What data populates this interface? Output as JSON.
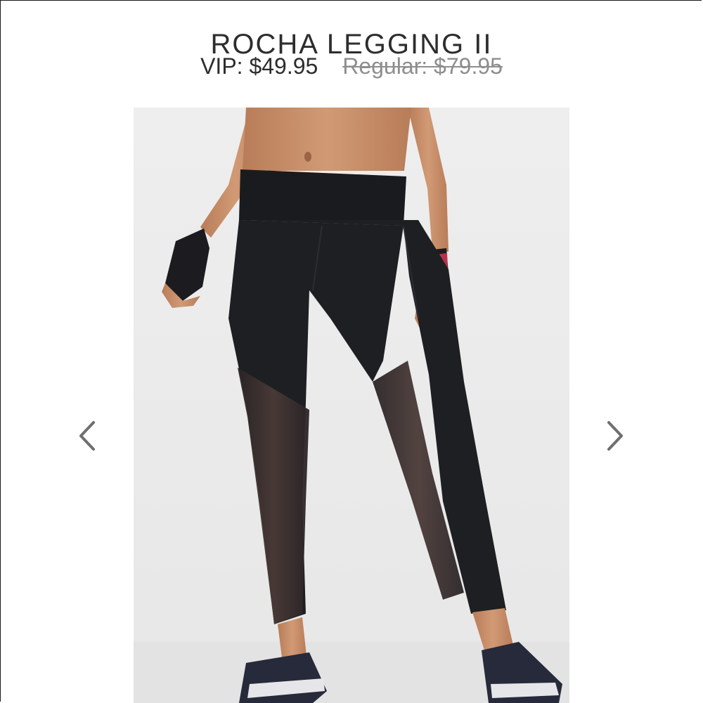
{
  "product": {
    "title": "ROCHA LEGGING II",
    "vip_price": "VIP: $49.95",
    "regular_price": "Regular: $79.95"
  },
  "carousel": {
    "prev_icon": "chevron-left-icon",
    "next_icon": "chevron-right-icon",
    "arrow_color": "#6f6f6f"
  },
  "image": {
    "alt": "Model wearing black leggings with sheer mesh leg panels, fingerless gloves and navy sneakers"
  },
  "colors": {
    "text": "#2d2d2d",
    "muted": "#8e8e8e",
    "legging": "#1e1f22",
    "skin": "#c98f6c",
    "backdrop": "#ececec"
  }
}
